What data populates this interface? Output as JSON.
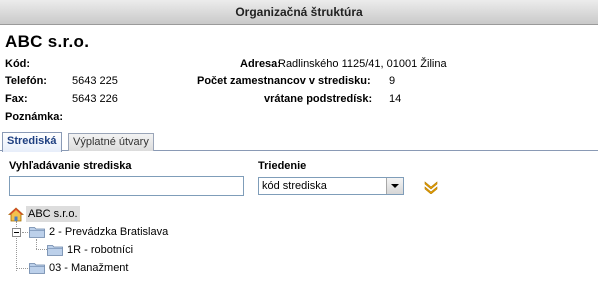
{
  "window": {
    "title": "Organizačná štruktúra"
  },
  "company": {
    "name": "ABC s.r.o."
  },
  "details": {
    "kod_label": "Kód:",
    "kod_value": "",
    "telefon_label": "Telefón:",
    "telefon_value": "5643 225",
    "fax_label": "Fax:",
    "fax_value": "5643 226",
    "poznamka_label": "Poznámka:",
    "adresa_label": "Adresa:",
    "adresa_value": "Radlinského 1125/41, 01001 Žilina",
    "pocet_label": "Počet zamestnancov v stredisku:",
    "pocet_value": "9",
    "vratane_label": "vrátane podstredísk:",
    "vratane_value": "14"
  },
  "tabs": [
    {
      "label": "Strediská",
      "active": true
    },
    {
      "label": "Výplatné útvary",
      "active": false
    }
  ],
  "search": {
    "label": "Vyhľadávanie strediska",
    "value": "",
    "placeholder": ""
  },
  "sort": {
    "label": "Triedenie",
    "selected": "kód strediska"
  },
  "tree": [
    {
      "label": "ABC s.r.o.",
      "icon": "home-icon",
      "level": 0,
      "selected": true
    },
    {
      "label": "2 - Prevádzka Bratislava",
      "icon": "folder-icon",
      "level": 1,
      "expanded": true
    },
    {
      "label": "1R - robotníci",
      "icon": "folder-icon",
      "level": 2
    },
    {
      "label": "03 - Manažment",
      "icon": "folder-icon",
      "level": 1
    }
  ],
  "colors": {
    "accent": "#1e3f80",
    "expand_icon": "#e8a000",
    "folder": "#bcd0ea"
  }
}
